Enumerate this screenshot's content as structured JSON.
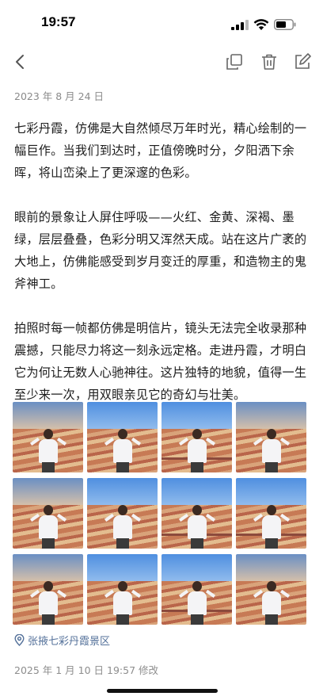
{
  "status_bar": {
    "time": "19:57"
  },
  "nav": {
    "back_icon": "chevron-left-icon",
    "copy_icon": "copy-icon",
    "delete_icon": "trash-icon",
    "edit_icon": "edit-icon"
  },
  "note": {
    "date": "2023 年 8 月 24 日",
    "paragraphs": [
      "七彩丹霞，仿佛是大自然倾尽万年时光，精心绘制的一幅巨作。当我们到达时，正值傍晚时分，夕阳洒下余晖，将山峦染上了更深邃的色彩。",
      "眼前的景象让人屏住呼吸——火红、金黄、深褐、墨绿，层层叠叠，色彩分明又浑然天成。站在这片广袤的大地上，仿佛能感受到岁月变迁的厚重，和造物主的鬼斧神工。",
      "拍照时每一帧都仿佛是明信片，镜头无法完全收录那种震撼，只能尽力将这一刻永远定格。走进丹霞，才明白它为何让无数人心驰神往。这片独特的地貌，值得一生至少来一次，用双眼亲见它的奇幻与壮美。"
    ],
    "photo_count": 12,
    "location": "张掖七彩丹霞景区",
    "modified": "2025 年 1 月 10 日 19:57 修改"
  },
  "colors": {
    "accent_link": "#54719a",
    "meta_text": "#8a8a8a"
  }
}
